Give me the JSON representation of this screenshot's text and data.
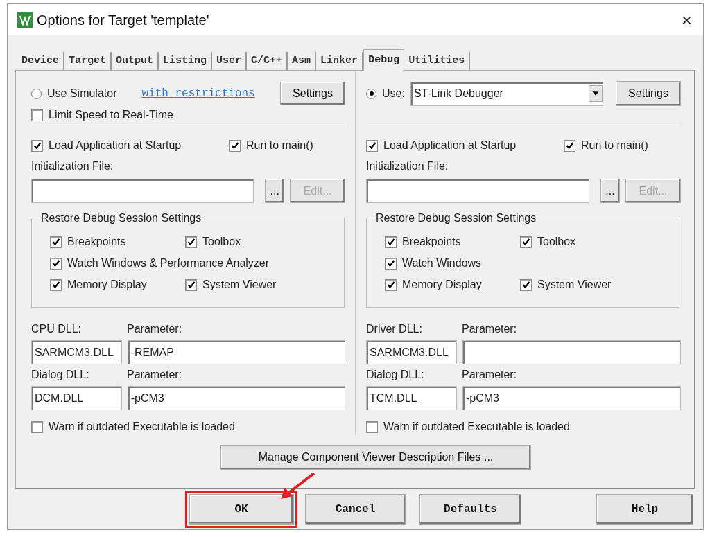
{
  "window": {
    "title": "Options for Target 'template'",
    "close": "×"
  },
  "tabs": [
    {
      "label": "Device",
      "selected": false
    },
    {
      "label": "Target",
      "selected": false
    },
    {
      "label": "Output",
      "selected": false
    },
    {
      "label": "Listing",
      "selected": false
    },
    {
      "label": "User",
      "selected": false
    },
    {
      "label": "C/C++",
      "selected": false
    },
    {
      "label": "Asm",
      "selected": false
    },
    {
      "label": "Linker",
      "selected": false
    },
    {
      "label": "Debug",
      "selected": true
    },
    {
      "label": "Utilities",
      "selected": false
    }
  ],
  "panels": [
    {
      "kind": "simulator",
      "use": {
        "label": "Use Simulator",
        "selected": false
      },
      "link": "with restrictions",
      "settings": "Settings",
      "limit_speed": {
        "label": "Limit Speed to Real-Time",
        "checked": false
      },
      "load_app": {
        "label": "Load Application at Startup",
        "checked": true
      },
      "run_to_main": {
        "label": "Run to main()",
        "checked": true
      },
      "init_label": "Initialization File:",
      "browse": "...",
      "edit": {
        "label": "Edit...",
        "disabled": true
      },
      "restore": {
        "title": "Restore Debug Session Settings",
        "rows": [
          [
            {
              "label": "Breakpoints",
              "checked": true
            },
            {
              "label": "Toolbox",
              "checked": true
            }
          ],
          [
            {
              "label": "Watch Windows & Performance Analyzer",
              "checked": true
            }
          ],
          [
            {
              "label": "Memory Display",
              "checked": true
            },
            {
              "label": "System Viewer",
              "checked": true
            }
          ]
        ]
      },
      "dlls": [
        {
          "dll_label": "CPU DLL:",
          "dll_value": "SARMCM3.DLL",
          "param_label": "Parameter:",
          "param_value": "-REMAP"
        },
        {
          "dll_label": "Dialog DLL:",
          "dll_value": "DCM.DLL",
          "param_label": "Parameter:",
          "param_value": "-pCM3"
        }
      ],
      "warn": {
        "label": "Warn if outdated Executable is loaded",
        "checked": false
      }
    },
    {
      "kind": "target",
      "use": {
        "label": "Use:",
        "selected": true
      },
      "debugger": "ST-Link Debugger",
      "settings": "Settings",
      "load_app": {
        "label": "Load Application at Startup",
        "checked": true
      },
      "run_to_main": {
        "label": "Run to main()",
        "checked": true
      },
      "init_label": "Initialization File:",
      "browse": "...",
      "edit": {
        "label": "Edit...",
        "disabled": true
      },
      "restore": {
        "title": "Restore Debug Session Settings",
        "rows": [
          [
            {
              "label": "Breakpoints",
              "checked": true
            },
            {
              "label": "Toolbox",
              "checked": true
            }
          ],
          [
            {
              "label": "Watch Windows",
              "checked": true
            }
          ],
          [
            {
              "label": "Memory Display",
              "checked": true
            },
            {
              "label": "System Viewer",
              "checked": true
            }
          ]
        ]
      },
      "dlls": [
        {
          "dll_label": "Driver DLL:",
          "dll_value": "SARMCM3.DLL",
          "param_label": "Parameter:"
        },
        {
          "dll_label": "Dialog DLL:",
          "dll_value": "TCM.DLL",
          "param_label": "Parameter:",
          "param_value": "-pCM3"
        }
      ],
      "warn": {
        "label": "Warn if outdated Executable is loaded",
        "checked": false
      }
    }
  ],
  "manage_button": "Manage Component Viewer Description Files ...",
  "buttons": [
    {
      "label": "OK",
      "highlighted": true
    },
    {
      "label": "Cancel",
      "highlighted": false
    },
    {
      "label": "Defaults",
      "highlighted": false
    },
    {
      "label": "Help",
      "highlighted": false
    }
  ]
}
